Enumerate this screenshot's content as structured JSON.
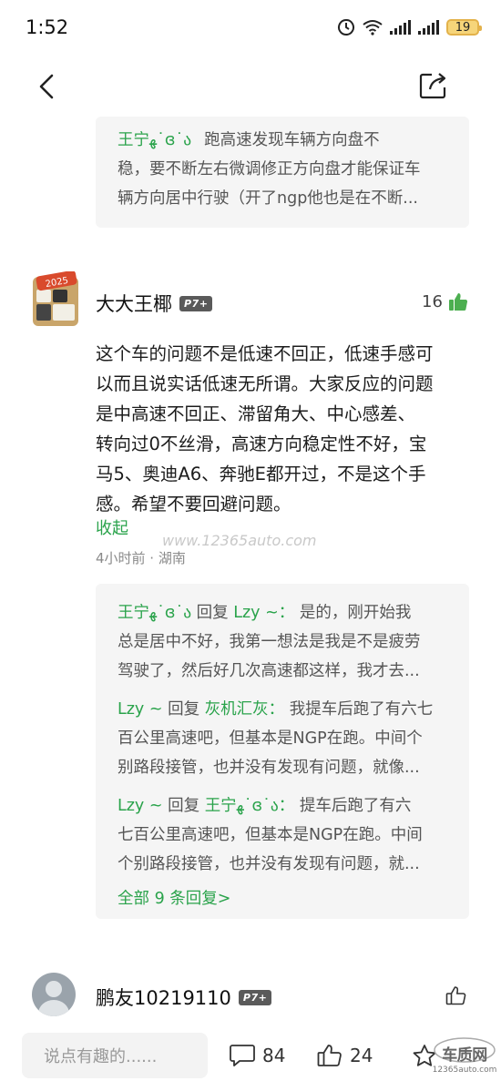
{
  "status_bar": {
    "time": "1:52",
    "battery": "19"
  },
  "reply_top": {
    "user": "王宁ﻬ˙ɞ˙ა",
    "lines": [
      "跑高速发现车辆方向盘不",
      "稳，要不断左右微调修正方向盘才能保证车",
      "辆方向居中行驶（开了ngp他也是在不断..."
    ]
  },
  "comment": {
    "author": "大大王椰",
    "badge": "P7+",
    "likes": "16",
    "text_lines": [
      "这个车的问题不是低速不回正，低速手感可",
      "以而且说实话低速无所谓。大家反应的问题",
      "是中高速不回正、滞留角大、中心感差、",
      "转向过0不丝滑，高速方向稳定性不好，宝",
      "马5、奥迪A6、奔驰E都开过，不是这个手",
      "感。希望不要回避问题。"
    ],
    "collapse_label": "收起",
    "meta": "4小时前 · 湖南",
    "watermark": "www.12365auto.com",
    "replies": [
      {
        "user": "王宁ﻬ˙ɞ˙ა",
        "reply_word": "回复",
        "target": "Lzy ~：",
        "lines": [
          "是的，刚开始我",
          "总是居中不好，我第一想法是我是不是疲劳",
          "驾驶了，然后好几次高速都这样，我才去..."
        ]
      },
      {
        "user": "Lzy ~",
        "reply_word": "回复",
        "target": "灰机汇灰：",
        "lines": [
          "我提车后跑了有六七",
          "百公里高速吧，但基本是NGP在跑。中间个",
          "别路段接管，也并没有发现有问题，就像..."
        ]
      },
      {
        "user": "Lzy ~",
        "reply_word": "回复",
        "target": "王宁ﻬ˙ɞ˙ა：",
        "lines": [
          "提车后跑了有六",
          "七百公里高速吧，但基本是NGP在跑。中间",
          "个别路段接管，也并没有发现有问题，就..."
        ]
      }
    ],
    "all_replies_label": "全部 9 条回复>"
  },
  "next_comment": {
    "author": "鹏友10219110",
    "badge": "P7+"
  },
  "bottom_bar": {
    "input_placeholder": "说点有趣的......",
    "comments_count": "84",
    "likes_count": "24"
  },
  "logo_text": {
    "main": "车质网",
    "url": "12365auto.com"
  }
}
